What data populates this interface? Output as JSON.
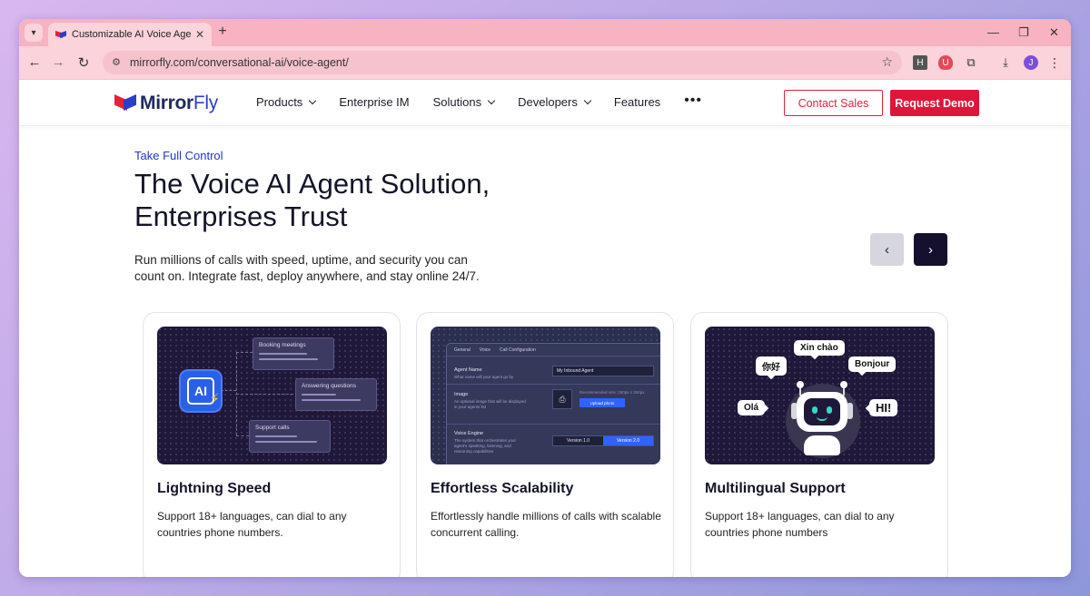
{
  "browser": {
    "tab_title": "Customizable AI Voice Agents f",
    "tab_close": "✕",
    "new_tab": "+",
    "url": "mirrorfly.com/conversational-ai/voice-agent/",
    "profile_initial": "J"
  },
  "header": {
    "logo_mirror": "Mirror",
    "logo_fly": "Fly",
    "nav": {
      "products": "Products",
      "enterprise_im": "Enterprise IM",
      "solutions": "Solutions",
      "developers": "Developers",
      "features": "Features",
      "more": "•••"
    },
    "contact_sales": "Contact Sales",
    "request_demo": "Request Demo"
  },
  "hero": {
    "eyebrow": "Take Full Control",
    "title_line1": "The Voice AI Agent Solution,",
    "title_line2": "Enterprises Trust",
    "description": "Run millions of calls with speed, uptime, and security you can count on. Integrate fast, deploy anywhere, and stay online 24/7."
  },
  "cards": [
    {
      "title": "Lightning Speed",
      "description": "Support 18+ languages, can dial to any countries phone numbers.",
      "illustration": {
        "badge": "AI",
        "items": [
          "Booking meetings",
          "Answering questions",
          "Support calls"
        ]
      }
    },
    {
      "title": "Effortless Scalability",
      "description": "Effortlessly handle millions of calls with scalable concurrent calling.",
      "illustration": {
        "tabs": [
          "General",
          "Voice",
          "Call Configuration"
        ],
        "agent_name_label": "Agent Name",
        "agent_name_sub": "What name will your agent go by",
        "agent_name_value": "My Inbound Agent",
        "image_label": "Image",
        "image_sub": "An optional image that will be displayed in your agents list",
        "upload_note": "Recommended size: 250px x 250px",
        "upload_button": "Upload photo",
        "voice_engine_label": "Voice Engine",
        "voice_engine_sub": "The system that orchestrates your agent's speaking, listening, and reasoning capabilities",
        "versions": [
          "Version 1.0",
          "Version 2.0"
        ]
      }
    },
    {
      "title": "Multilingual Support",
      "description": "Support 18+ languages, can dial to any countries phone numbers",
      "illustration": {
        "greetings": [
          "Xin chào",
          "你好",
          "Bonjour",
          "Olá",
          "HI!"
        ]
      }
    }
  ],
  "colors": {
    "brand_red": "#e0153a",
    "brand_blue": "#1e35c9",
    "dark_navy": "#14102e"
  }
}
